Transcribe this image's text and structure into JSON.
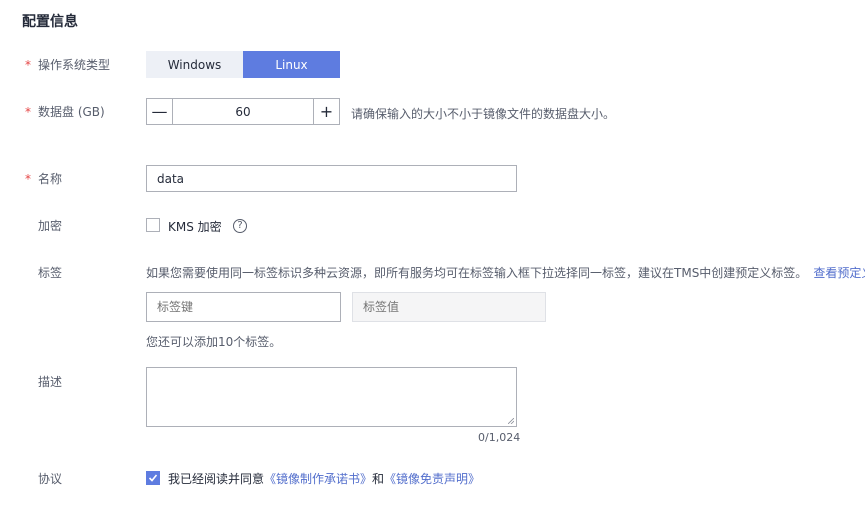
{
  "section_title": "配置信息",
  "required_mark": "*",
  "os": {
    "label": "操作系统类型",
    "options": [
      "Windows",
      "Linux"
    ],
    "selected": "Linux"
  },
  "disk": {
    "label": "数据盘 (GB)",
    "minus": "—",
    "plus": "+",
    "value": "60",
    "hint": "请确保输入的大小不小于镜像文件的数据盘大小。"
  },
  "name": {
    "label": "名称",
    "value": "data"
  },
  "encrypt": {
    "label": "加密",
    "checkbox_label": "KMS 加密",
    "help_glyph": "?"
  },
  "tags": {
    "label": "标签",
    "description": "如果您需要使用同一标签标识多种云资源，即所有服务均可在标签输入框下拉选择同一标签，建议在TMS中创建预定义标签。",
    "link": "查看预定义标",
    "key_placeholder": "标签键",
    "value_placeholder": "标签值",
    "remaining": "您还可以添加10个标签。"
  },
  "description": {
    "label": "描述",
    "counter": "0/1,024"
  },
  "agreement": {
    "label": "协议",
    "prefix": "我已经阅读并同意",
    "link1": "《镜像制作承诺书》",
    "middle": "和",
    "link2": "《镜像免责声明》",
    "checked": true
  },
  "colors": {
    "accent": "#5e7ce0",
    "required": "#e54545",
    "link": "#526ecc"
  }
}
